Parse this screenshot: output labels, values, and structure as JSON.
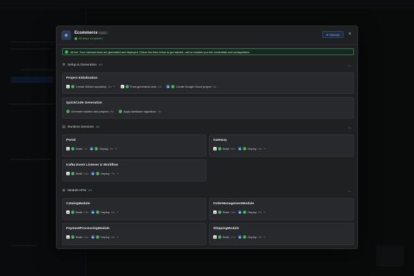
{
  "modal": {
    "title": "Ecommerce",
    "id_badge": "#1322",
    "status": "All steps completed",
    "refresh_label": "Refresh",
    "close_glyph": "×"
  },
  "alert": "All set. Your microservices are generated and deployed. Check the links below to get started—we've emailed you the credentials and configuration.",
  "sections": {
    "setup": {
      "title": "Setup & Generation",
      "count": "3/3"
    },
    "runtime": {
      "title": "Runtime Services",
      "count": "3/3"
    },
    "module": {
      "title": "Module APIs",
      "count": "4/4"
    }
  },
  "cards": {
    "project_init": {
      "title": "Project Initialization",
      "steps": [
        {
          "label": "Create GitHub repository",
          "dur": "11s"
        },
        {
          "label": "Push generated code",
          "dur": "10s"
        },
        {
          "label": "Create Google Cloud project",
          "dur": "40s"
        }
      ]
    },
    "quickcode": {
      "title": "QuickCode Generation",
      "steps": [
        {
          "label": "Generate solution and projects",
          "dur": "85s"
        },
        {
          "label": "Apply database migrations",
          "dur": "15s"
        }
      ]
    },
    "portal": {
      "title": "Portal",
      "build": "Build",
      "build_dur": "72s",
      "deploy": "Deploy",
      "deploy_dur": "41s"
    },
    "gateway": {
      "title": "Gateway",
      "build": "Build",
      "build_dur": "161s",
      "deploy": "Deploy",
      "deploy_dur": "40s"
    },
    "kafka": {
      "title": "Kafka Event Listener & Workflow",
      "build": "Build",
      "build_dur": "146s",
      "deploy": "Deploy",
      "deploy_dur": "73s"
    },
    "catalog": {
      "title": "CatalogModule",
      "build": "Build",
      "build_dur": "108s",
      "deploy": "Deploy",
      "deploy_dur": "40s"
    },
    "order": {
      "title": "OrderManagementModule",
      "build": "Build",
      "build_dur": "158s",
      "deploy": "Deploy",
      "deploy_dur": "43s"
    },
    "payment": {
      "title": "PaymentProcessingModule",
      "build": "Build",
      "build_dur": "146s",
      "deploy": "Deploy",
      "deploy_dur": "43s"
    },
    "shipping": {
      "title": "ShippingModule",
      "build": "Build",
      "build_dur": "171s",
      "deploy": "Deploy",
      "deploy_dur": "40s"
    }
  },
  "icons": {
    "github": "github-icon",
    "check": "check-circle-icon",
    "gcloud": "google-cloud-icon",
    "chevron": "chevron-down-icon"
  },
  "colors": {
    "accent": "#3aa655",
    "primary": "#4a7fd6",
    "surface": "#1e2022"
  }
}
